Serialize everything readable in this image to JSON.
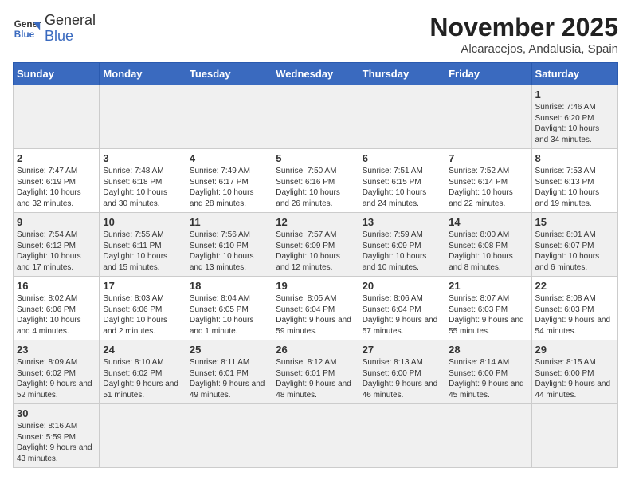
{
  "logo": {
    "line1": "General",
    "line2": "Blue"
  },
  "title": "November 2025",
  "subtitle": "Alcaracejos, Andalusia, Spain",
  "weekdays": [
    "Sunday",
    "Monday",
    "Tuesday",
    "Wednesday",
    "Thursday",
    "Friday",
    "Saturday"
  ],
  "weeks": [
    [
      {
        "day": "",
        "info": ""
      },
      {
        "day": "",
        "info": ""
      },
      {
        "day": "",
        "info": ""
      },
      {
        "day": "",
        "info": ""
      },
      {
        "day": "",
        "info": ""
      },
      {
        "day": "",
        "info": ""
      },
      {
        "day": "1",
        "info": "Sunrise: 7:46 AM\nSunset: 6:20 PM\nDaylight: 10 hours and 34 minutes."
      }
    ],
    [
      {
        "day": "2",
        "info": "Sunrise: 7:47 AM\nSunset: 6:19 PM\nDaylight: 10 hours and 32 minutes."
      },
      {
        "day": "3",
        "info": "Sunrise: 7:48 AM\nSunset: 6:18 PM\nDaylight: 10 hours and 30 minutes."
      },
      {
        "day": "4",
        "info": "Sunrise: 7:49 AM\nSunset: 6:17 PM\nDaylight: 10 hours and 28 minutes."
      },
      {
        "day": "5",
        "info": "Sunrise: 7:50 AM\nSunset: 6:16 PM\nDaylight: 10 hours and 26 minutes."
      },
      {
        "day": "6",
        "info": "Sunrise: 7:51 AM\nSunset: 6:15 PM\nDaylight: 10 hours and 24 minutes."
      },
      {
        "day": "7",
        "info": "Sunrise: 7:52 AM\nSunset: 6:14 PM\nDaylight: 10 hours and 22 minutes."
      },
      {
        "day": "8",
        "info": "Sunrise: 7:53 AM\nSunset: 6:13 PM\nDaylight: 10 hours and 19 minutes."
      }
    ],
    [
      {
        "day": "9",
        "info": "Sunrise: 7:54 AM\nSunset: 6:12 PM\nDaylight: 10 hours and 17 minutes."
      },
      {
        "day": "10",
        "info": "Sunrise: 7:55 AM\nSunset: 6:11 PM\nDaylight: 10 hours and 15 minutes."
      },
      {
        "day": "11",
        "info": "Sunrise: 7:56 AM\nSunset: 6:10 PM\nDaylight: 10 hours and 13 minutes."
      },
      {
        "day": "12",
        "info": "Sunrise: 7:57 AM\nSunset: 6:09 PM\nDaylight: 10 hours and 12 minutes."
      },
      {
        "day": "13",
        "info": "Sunrise: 7:59 AM\nSunset: 6:09 PM\nDaylight: 10 hours and 10 minutes."
      },
      {
        "day": "14",
        "info": "Sunrise: 8:00 AM\nSunset: 6:08 PM\nDaylight: 10 hours and 8 minutes."
      },
      {
        "day": "15",
        "info": "Sunrise: 8:01 AM\nSunset: 6:07 PM\nDaylight: 10 hours and 6 minutes."
      }
    ],
    [
      {
        "day": "16",
        "info": "Sunrise: 8:02 AM\nSunset: 6:06 PM\nDaylight: 10 hours and 4 minutes."
      },
      {
        "day": "17",
        "info": "Sunrise: 8:03 AM\nSunset: 6:06 PM\nDaylight: 10 hours and 2 minutes."
      },
      {
        "day": "18",
        "info": "Sunrise: 8:04 AM\nSunset: 6:05 PM\nDaylight: 10 hours and 1 minute."
      },
      {
        "day": "19",
        "info": "Sunrise: 8:05 AM\nSunset: 6:04 PM\nDaylight: 9 hours and 59 minutes."
      },
      {
        "day": "20",
        "info": "Sunrise: 8:06 AM\nSunset: 6:04 PM\nDaylight: 9 hours and 57 minutes."
      },
      {
        "day": "21",
        "info": "Sunrise: 8:07 AM\nSunset: 6:03 PM\nDaylight: 9 hours and 55 minutes."
      },
      {
        "day": "22",
        "info": "Sunrise: 8:08 AM\nSunset: 6:03 PM\nDaylight: 9 hours and 54 minutes."
      }
    ],
    [
      {
        "day": "23",
        "info": "Sunrise: 8:09 AM\nSunset: 6:02 PM\nDaylight: 9 hours and 52 minutes."
      },
      {
        "day": "24",
        "info": "Sunrise: 8:10 AM\nSunset: 6:02 PM\nDaylight: 9 hours and 51 minutes."
      },
      {
        "day": "25",
        "info": "Sunrise: 8:11 AM\nSunset: 6:01 PM\nDaylight: 9 hours and 49 minutes."
      },
      {
        "day": "26",
        "info": "Sunrise: 8:12 AM\nSunset: 6:01 PM\nDaylight: 9 hours and 48 minutes."
      },
      {
        "day": "27",
        "info": "Sunrise: 8:13 AM\nSunset: 6:00 PM\nDaylight: 9 hours and 46 minutes."
      },
      {
        "day": "28",
        "info": "Sunrise: 8:14 AM\nSunset: 6:00 PM\nDaylight: 9 hours and 45 minutes."
      },
      {
        "day": "29",
        "info": "Sunrise: 8:15 AM\nSunset: 6:00 PM\nDaylight: 9 hours and 44 minutes."
      }
    ],
    [
      {
        "day": "30",
        "info": "Sunrise: 8:16 AM\nSunset: 5:59 PM\nDaylight: 9 hours and 43 minutes."
      },
      {
        "day": "",
        "info": ""
      },
      {
        "day": "",
        "info": ""
      },
      {
        "day": "",
        "info": ""
      },
      {
        "day": "",
        "info": ""
      },
      {
        "day": "",
        "info": ""
      },
      {
        "day": "",
        "info": ""
      }
    ]
  ]
}
